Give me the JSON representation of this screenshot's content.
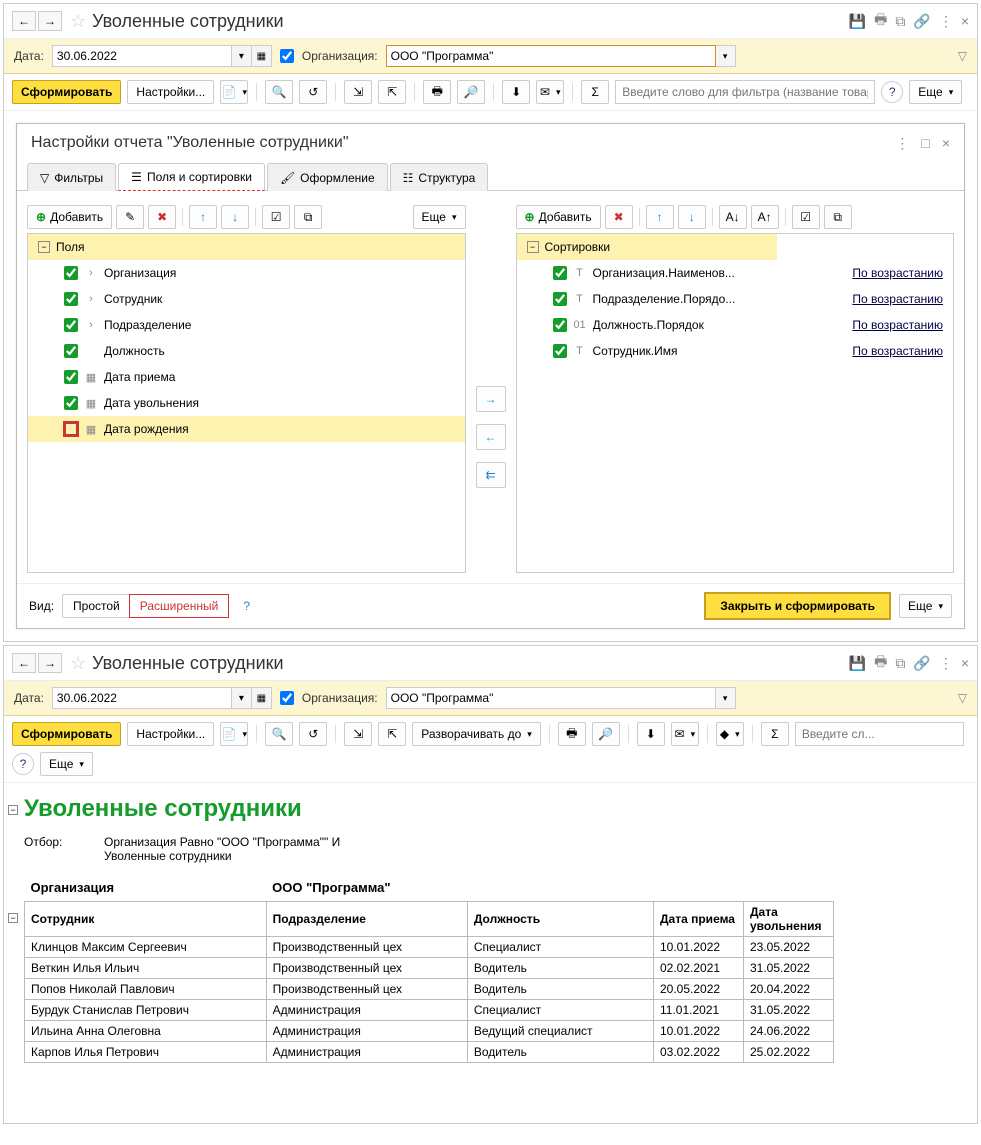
{
  "labels": {
    "date": "Дата:",
    "org": "Организация:",
    "view": "Вид:"
  },
  "top": {
    "title": "Уволенные сотрудники",
    "date_value": "30.06.2022",
    "org_value": "ООО \"Программа\""
  },
  "toolbar": {
    "form": "Сформировать",
    "settings": "Настройки...",
    "expand_to": "Разворачивать до",
    "more": "Еще",
    "search_ph_long": "Введите слово для фильтра (название товар...",
    "search_ph_short": "Введите сл..."
  },
  "dialog": {
    "title": "Настройки отчета \"Уволенные сотрудники\"",
    "tabs": {
      "filters": "Фильтры",
      "fields": "Поля и сортировки",
      "design": "Оформление",
      "struct": "Структура"
    },
    "add": "Добавить",
    "more": "Еще",
    "fields_header": "Поля",
    "sort_header": "Сортировки",
    "fields": [
      {
        "label": "Организация",
        "checked": true,
        "icon": ">"
      },
      {
        "label": "Сотрудник",
        "checked": true,
        "icon": ">"
      },
      {
        "label": "Подразделение",
        "checked": true,
        "icon": ">"
      },
      {
        "label": "Должность",
        "checked": true,
        "icon": ""
      },
      {
        "label": "Дата приема",
        "checked": true,
        "icon": "cal"
      },
      {
        "label": "Дата увольнения",
        "checked": true,
        "icon": "cal"
      },
      {
        "label": "Дата рождения",
        "checked": false,
        "icon": "cal"
      }
    ],
    "sorts": [
      {
        "label": "Организация.Наименов...",
        "type": "Т",
        "dir": "По возрастанию"
      },
      {
        "label": "Подразделение.Порядо...",
        "type": "Т",
        "dir": "По возрастанию"
      },
      {
        "label": "Должность.Порядок",
        "type": "01",
        "dir": "По возрастанию"
      },
      {
        "label": "Сотрудник.Имя",
        "type": "Т",
        "dir": "По возрастанию"
      }
    ],
    "view_simple": "Простой",
    "view_ext": "Расширенный",
    "help": "?",
    "close_form": "Закрыть и сформировать"
  },
  "bottom": {
    "title": "Уволенные сотрудники",
    "date_value": "30.06.2022",
    "org_value": "ООО \"Программа\""
  },
  "report": {
    "title": "Уволенные сотрудники",
    "filter_label": "Отбор:",
    "filter_value": "Организация Равно \"ООО \"Программа\"\" И\nУволенные сотрудники",
    "org_label": "Организация",
    "org_value": "ООО \"Программа\"",
    "headers": {
      "employee": "Сотрудник",
      "dept": "Подразделение",
      "post": "Должность",
      "hire": "Дата приема",
      "fire": "Дата увольнения"
    },
    "rows": [
      {
        "e": "Клинцов Максим Сергеевич",
        "d": "Производственный цех",
        "p": "Специалист",
        "h": "10.01.2022",
        "f": "23.05.2022"
      },
      {
        "e": "Веткин Илья Ильич",
        "d": "Производственный цех",
        "p": "Водитель",
        "h": "02.02.2021",
        "f": "31.05.2022"
      },
      {
        "e": "Попов Николай Павлович",
        "d": "Производственный цех",
        "p": "Водитель",
        "h": "20.05.2022",
        "f": "20.04.2022"
      },
      {
        "e": "Бурдук Станислав Петрович",
        "d": "Администрация",
        "p": "Специалист",
        "h": "11.01.2021",
        "f": "31.05.2022"
      },
      {
        "e": "Ильина Анна Олеговна",
        "d": "Администрация",
        "p": "Ведущий специалист",
        "h": "10.01.2022",
        "f": "24.06.2022"
      },
      {
        "e": "Карпов Илья Петрович",
        "d": "Администрация",
        "p": "Водитель",
        "h": "03.02.2022",
        "f": "25.02.2022"
      }
    ]
  }
}
